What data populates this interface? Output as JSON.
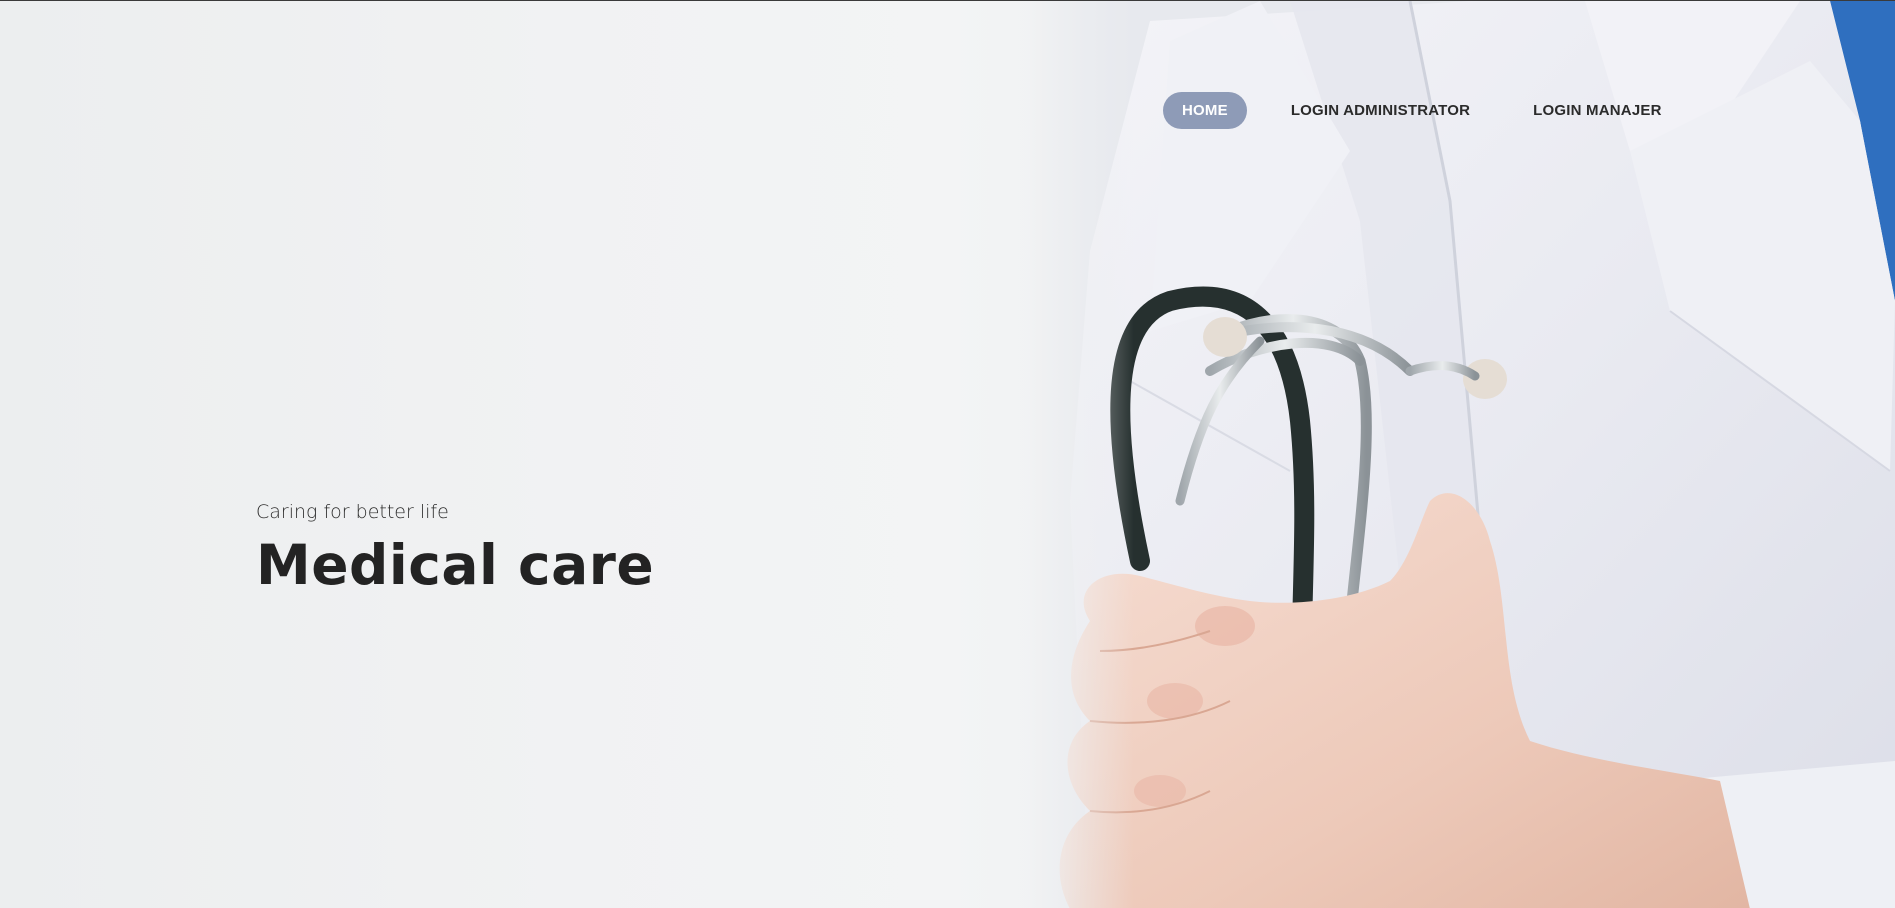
{
  "nav": {
    "items": [
      {
        "label": "HOME",
        "active": true
      },
      {
        "label": "LOGIN ADMINISTRATOR",
        "active": false
      },
      {
        "label": "LOGIN MANAJER",
        "active": false
      }
    ]
  },
  "hero": {
    "tagline": "Caring for better life",
    "headline": "Medical care",
    "image": "doctor-with-stethoscope-photo"
  },
  "colors": {
    "nav_active_bg": "#8e9bb7",
    "nav_active_text": "#ffffff",
    "text_dark": "#232323",
    "background": "#f1f2f3",
    "scrub_blue": "#2f6fbf",
    "stethoscope_dark": "#2a3236"
  }
}
